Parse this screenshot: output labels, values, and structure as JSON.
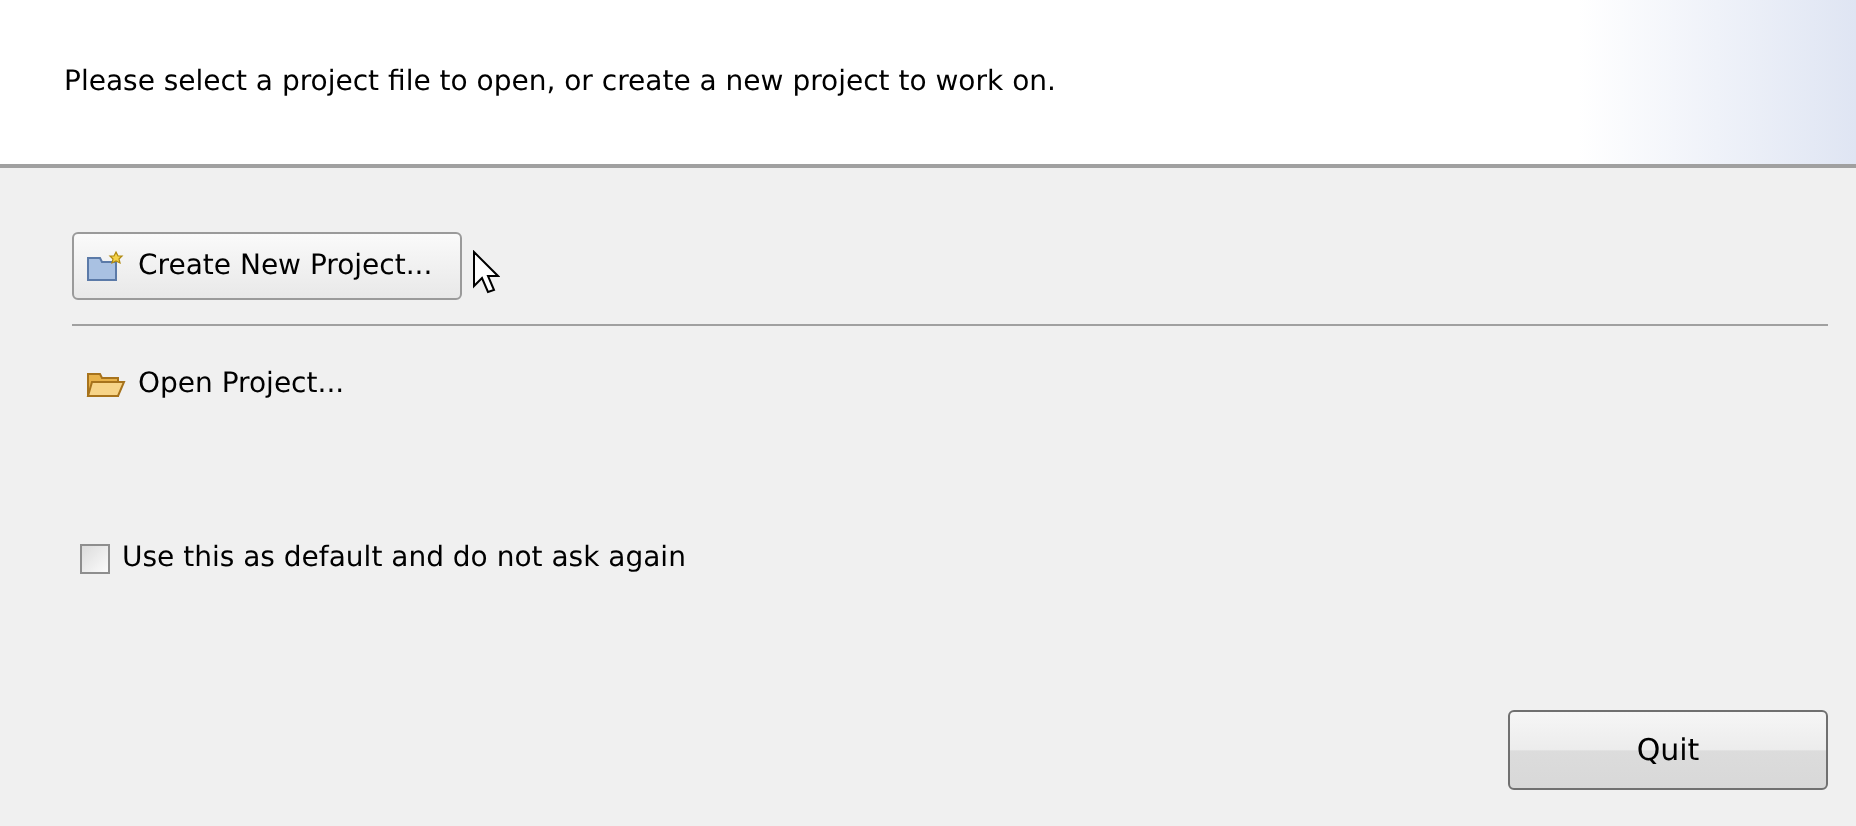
{
  "header": {
    "message": "Please select a project file to open, or create a new project to work on."
  },
  "actions": [
    {
      "kind": "new",
      "label": "Create New Project...",
      "hovered": true
    },
    {
      "kind": "open",
      "label": "Open Project...",
      "hovered": false
    }
  ],
  "default_checkbox": {
    "label": "Use this as default and do not ask again",
    "checked": false
  },
  "buttons": [
    "Quit"
  ]
}
